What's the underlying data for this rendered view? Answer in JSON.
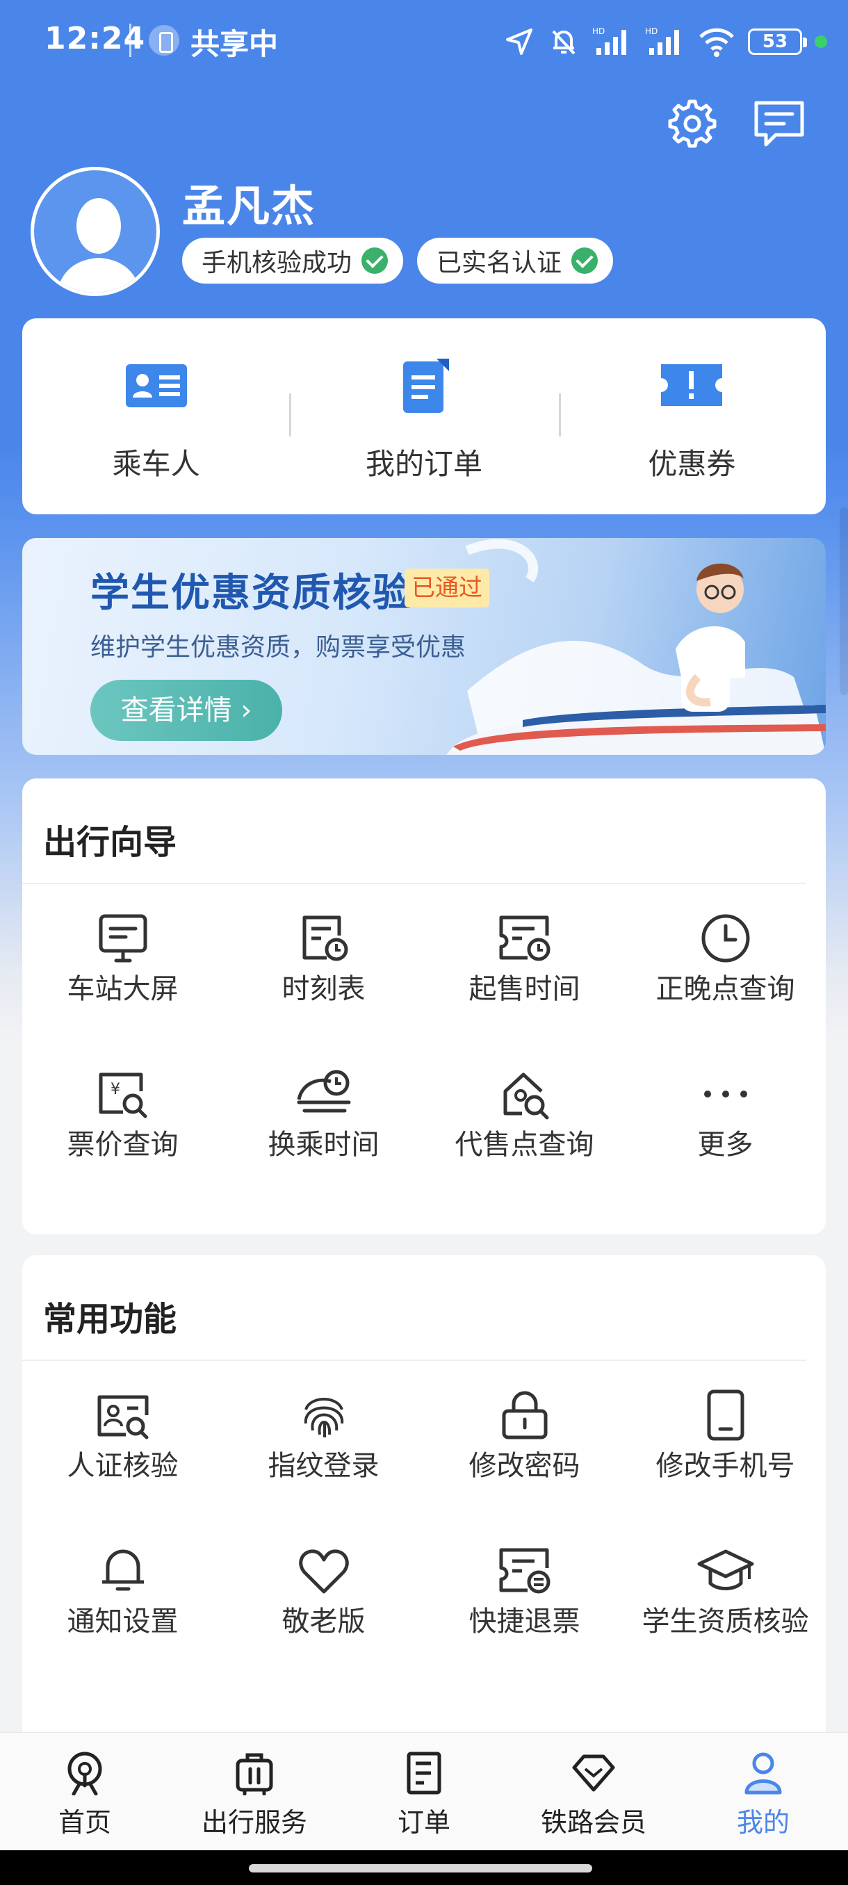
{
  "status_bar": {
    "time": "12:24",
    "share_label": "共享中",
    "battery": "53"
  },
  "header": {
    "settings_icon": "gear-icon",
    "message_icon": "message-icon"
  },
  "profile": {
    "name": "孟凡杰",
    "badges": [
      {
        "label": "手机核验成功"
      },
      {
        "label": "已实名认证"
      }
    ]
  },
  "quick_actions": [
    {
      "label": "乘车人",
      "icon": "passenger-card-icon"
    },
    {
      "label": "我的订单",
      "icon": "order-doc-icon"
    },
    {
      "label": "优惠券",
      "icon": "coupon-icon"
    }
  ],
  "banner": {
    "title": "学生优惠资质核验",
    "status": "已通过",
    "subtitle": "维护学生优惠资质，购票享受优惠",
    "button": "查看详情"
  },
  "travel_guide": {
    "title": "出行向导",
    "items": [
      {
        "label": "车站大屏",
        "icon": "station-screen-icon"
      },
      {
        "label": "时刻表",
        "icon": "timetable-icon"
      },
      {
        "label": "起售时间",
        "icon": "sale-time-icon"
      },
      {
        "label": "正晚点查询",
        "icon": "clock-icon"
      },
      {
        "label": "票价查询",
        "icon": "fare-search-icon"
      },
      {
        "label": "换乘时间",
        "icon": "transfer-time-icon"
      },
      {
        "label": "代售点查询",
        "icon": "agency-search-icon"
      },
      {
        "label": "更多",
        "icon": "more-icon"
      }
    ]
  },
  "common_functions": {
    "title": "常用功能",
    "items": [
      {
        "label": "人证核验",
        "icon": "id-verify-icon"
      },
      {
        "label": "指纹登录",
        "icon": "fingerprint-icon"
      },
      {
        "label": "修改密码",
        "icon": "lock-icon"
      },
      {
        "label": "修改手机号",
        "icon": "phone-icon"
      },
      {
        "label": "通知设置",
        "icon": "bell-icon"
      },
      {
        "label": "敬老版",
        "icon": "heart-icon"
      },
      {
        "label": "快捷退票",
        "icon": "refund-ticket-icon"
      },
      {
        "label": "学生资质核验",
        "icon": "graduation-cap-icon"
      }
    ]
  },
  "bottom_nav": {
    "active": "我的",
    "items": [
      {
        "label": "首页",
        "icon": "home-train-icon"
      },
      {
        "label": "出行服务",
        "icon": "luggage-icon"
      },
      {
        "label": "订单",
        "icon": "order-icon"
      },
      {
        "label": "铁路会员",
        "icon": "diamond-icon"
      },
      {
        "label": "我的",
        "icon": "person-icon"
      }
    ]
  },
  "colors": {
    "brand_blue": "#4a86ea",
    "success_green": "#3ab06a",
    "pass_orange": "#e65822"
  }
}
